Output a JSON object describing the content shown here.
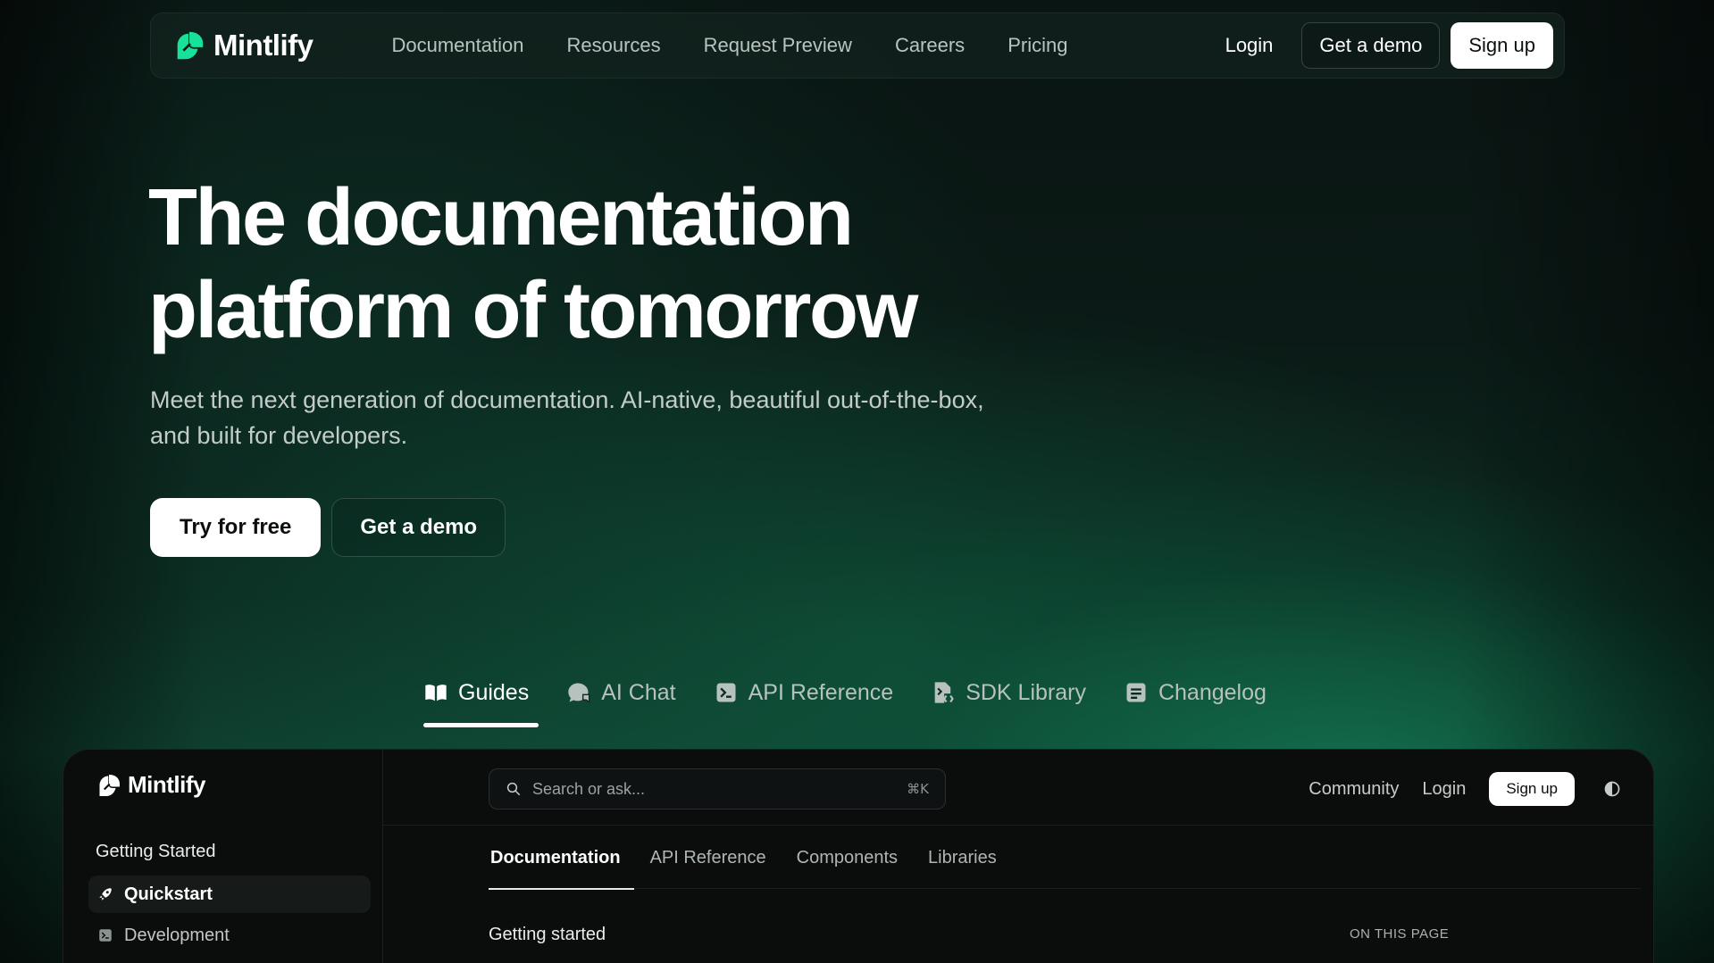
{
  "brand": {
    "name": "Mintlify",
    "accent": "#18E299"
  },
  "nav": {
    "links": [
      "Documentation",
      "Resources",
      "Request Preview",
      "Careers",
      "Pricing"
    ],
    "login": "Login",
    "demo": "Get a demo",
    "signup": "Sign up"
  },
  "hero": {
    "title_line1": "The documentation",
    "title_line2": "platform of tomorrow",
    "subtitle": "Meet the next generation of documentation. AI-native, beautiful out-of-the-box, and built for developers.",
    "cta_primary": "Try for free",
    "cta_secondary": "Get a demo"
  },
  "product_tabs": [
    {
      "label": "Guides",
      "icon": "book-icon",
      "active": true
    },
    {
      "label": "AI Chat",
      "icon": "chat-bubbles-icon"
    },
    {
      "label": "API Reference",
      "icon": "terminal-icon"
    },
    {
      "label": "SDK Library",
      "icon": "code-file-icon"
    },
    {
      "label": "Changelog",
      "icon": "list-document-icon"
    }
  ],
  "preview": {
    "brand": "Mintlify",
    "search": {
      "placeholder": "Search or ask...",
      "shortcut": "⌘K"
    },
    "top_links": {
      "community": "Community",
      "login": "Login",
      "signup": "Sign up"
    },
    "tabs": [
      "Documentation",
      "API Reference",
      "Components",
      "Libraries"
    ],
    "sidebar": {
      "section": "Getting Started",
      "items": [
        {
          "label": "Quickstart",
          "icon": "rocket-icon",
          "active": true
        },
        {
          "label": "Development",
          "icon": "terminal-icon"
        }
      ]
    },
    "content_heading": "Getting started",
    "on_this_page": "ON THIS PAGE"
  }
}
